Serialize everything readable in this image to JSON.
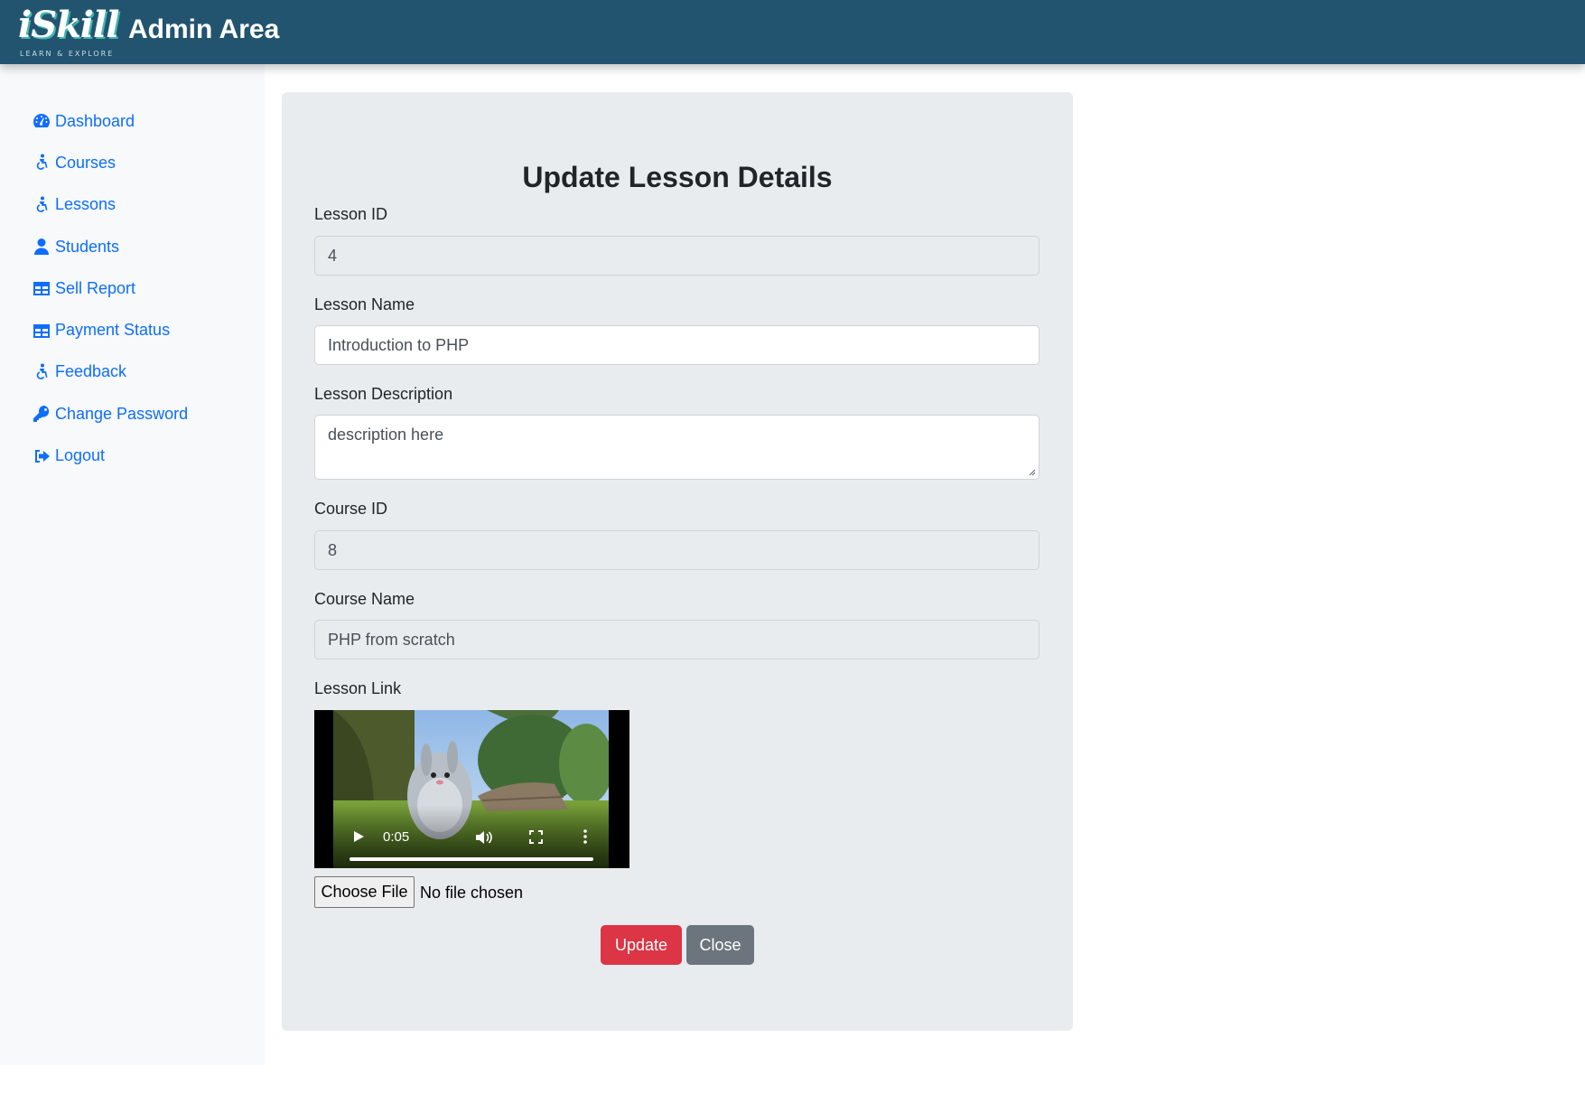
{
  "header": {
    "logo_text": "iSkill",
    "logo_tagline": "LEARN & EXPLORE",
    "title": "Admin Area"
  },
  "sidebar": {
    "items": [
      {
        "label": "Dashboard",
        "icon": "tachometer-icon"
      },
      {
        "label": "Courses",
        "icon": "accessible-icon"
      },
      {
        "label": "Lessons",
        "icon": "accessible-icon"
      },
      {
        "label": "Students",
        "icon": "user-icon"
      },
      {
        "label": "Sell Report",
        "icon": "table-icon"
      },
      {
        "label": "Payment Status",
        "icon": "table-icon"
      },
      {
        "label": "Feedback",
        "icon": "accessible-icon"
      },
      {
        "label": "Change Password",
        "icon": "key-icon"
      },
      {
        "label": "Logout",
        "icon": "sign-out-icon"
      }
    ]
  },
  "form": {
    "title": "Update Lesson Details",
    "lesson_id": {
      "label": "Lesson ID",
      "value": "4"
    },
    "lesson_name": {
      "label": "Lesson Name",
      "value": "Introduction to PHP"
    },
    "lesson_description": {
      "label": "Lesson Description",
      "value": "description here"
    },
    "course_id": {
      "label": "Course ID",
      "value": "8"
    },
    "course_name": {
      "label": "Course Name",
      "value": "PHP from scratch"
    },
    "lesson_link": {
      "label": "Lesson Link",
      "video_time": "0:05",
      "progress": 1.0
    },
    "file": {
      "button_label": "Choose File",
      "status": "No file chosen"
    },
    "update_label": "Update",
    "close_label": "Close"
  },
  "colors": {
    "header_bg": "#225470",
    "link": "#0d6efd",
    "update_btn": "#dc3545",
    "close_btn": "#6c757d",
    "card_bg": "#e9ecef",
    "sidebar_bg": "#f8f9fa"
  }
}
